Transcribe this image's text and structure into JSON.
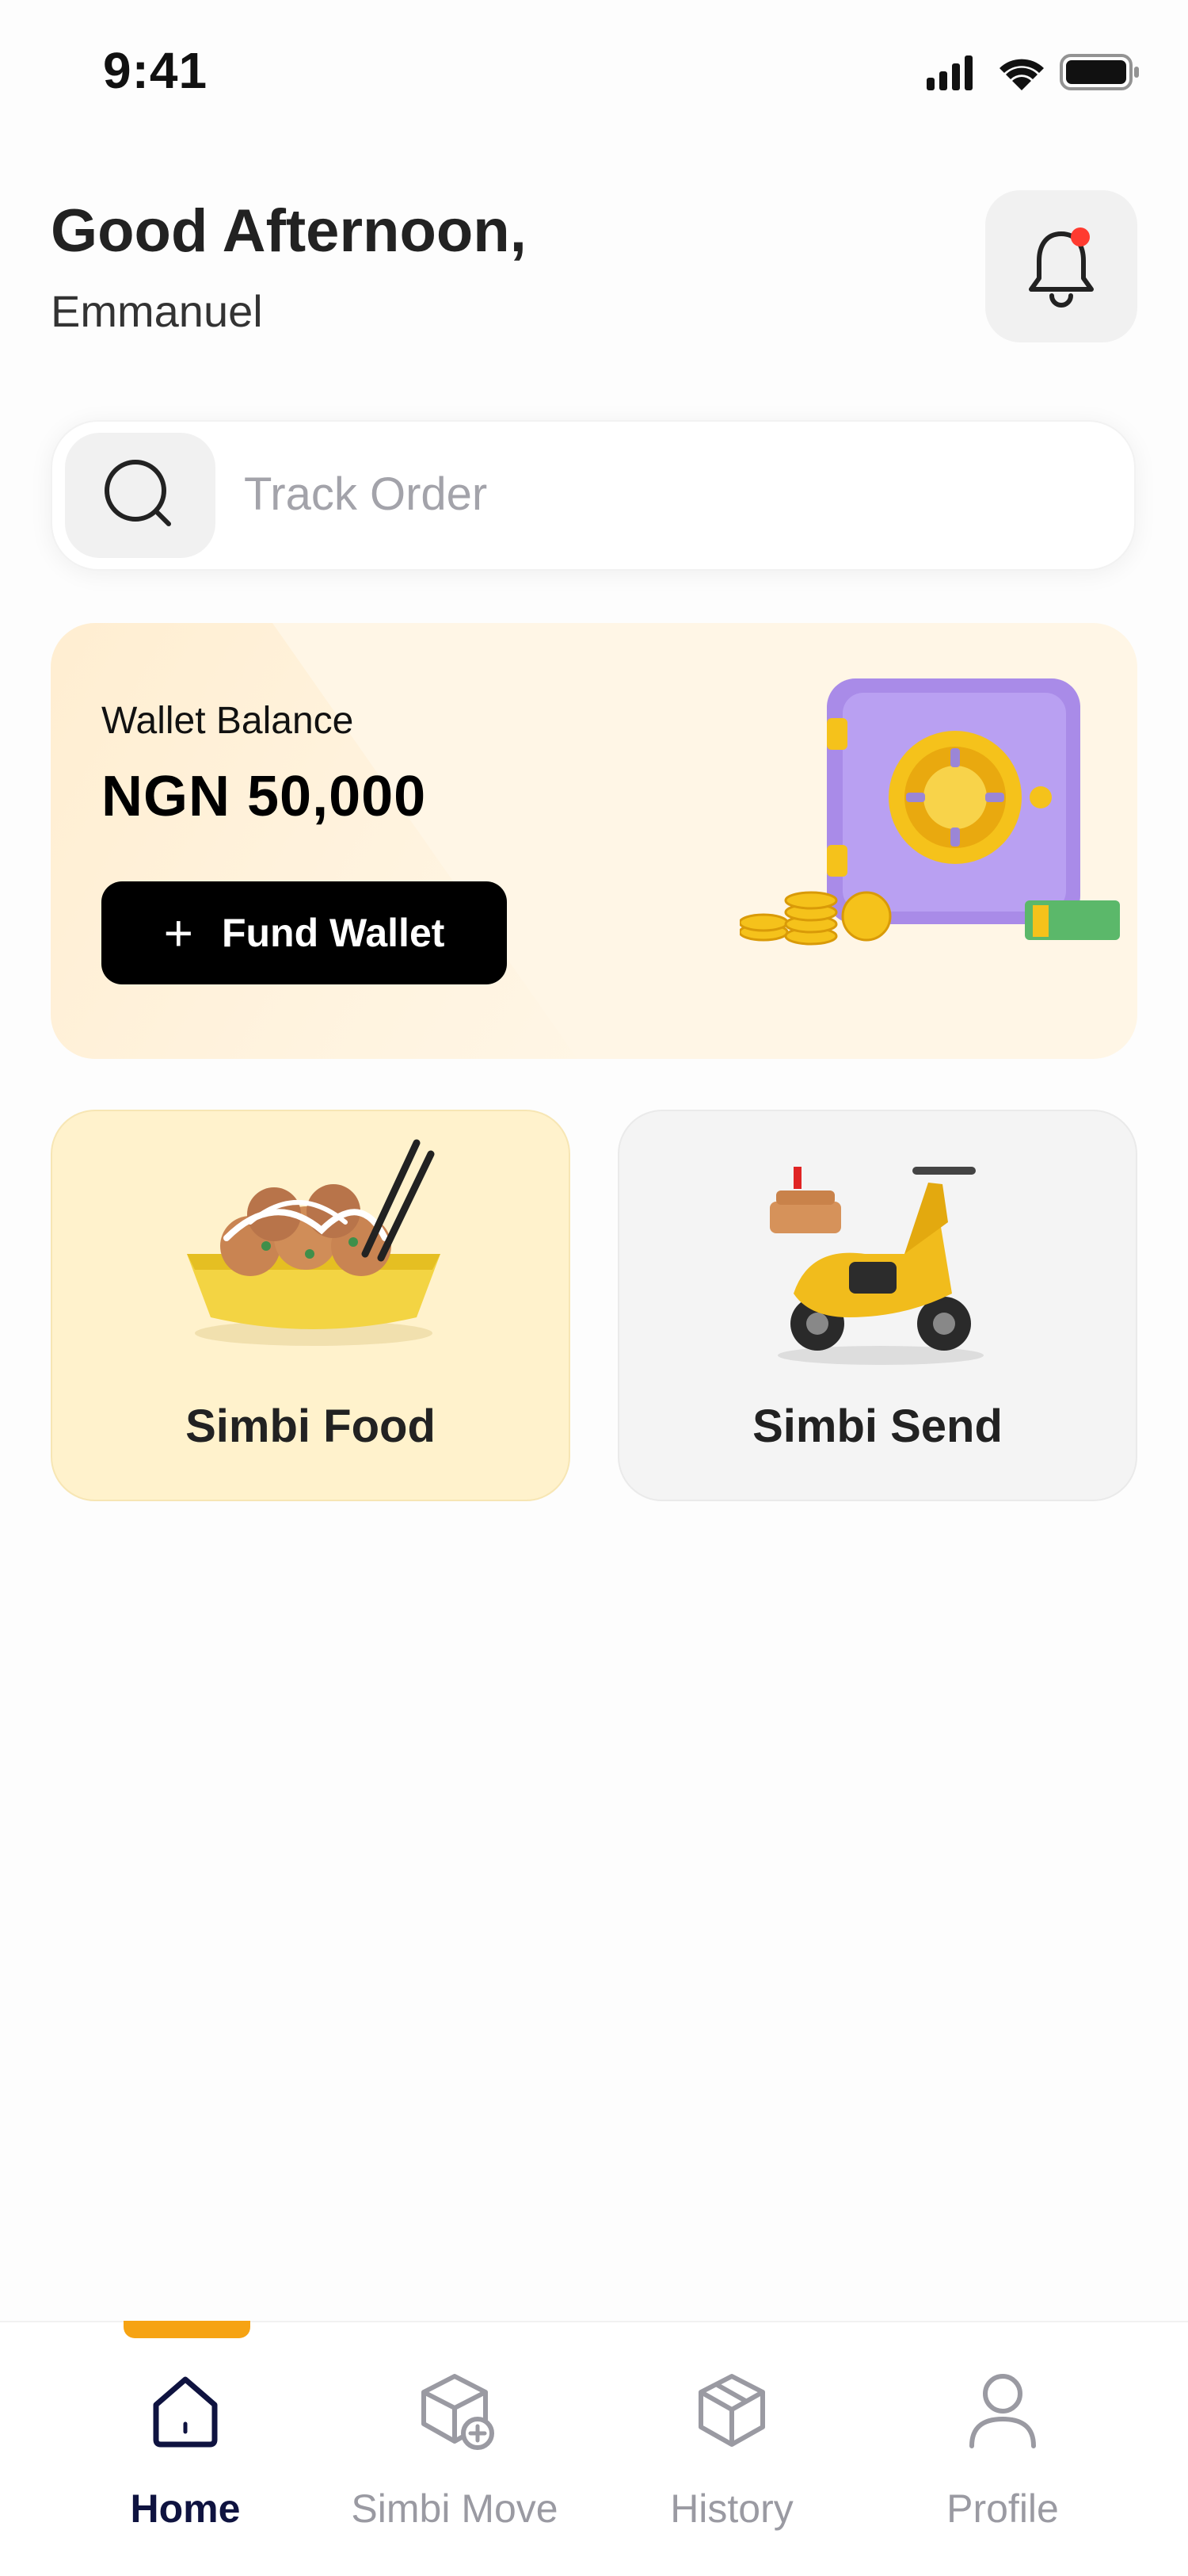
{
  "status_bar": {
    "time": "9:41"
  },
  "header": {
    "greeting": "Good Afternoon,",
    "name": "Emmanuel"
  },
  "search": {
    "placeholder": "Track Order"
  },
  "wallet": {
    "label": "Wallet Balance",
    "balance": "NGN 50,000",
    "fund_button_label": "Fund Wallet"
  },
  "services": [
    {
      "label": "Simbi Food",
      "icon": "food-bowl-icon"
    },
    {
      "label": "Simbi Send",
      "icon": "scooter-icon"
    }
  ],
  "nav": {
    "items": [
      {
        "label": "Home",
        "icon": "home-icon",
        "active": true
      },
      {
        "label": "Simbi Move",
        "icon": "box-add-icon",
        "active": false
      },
      {
        "label": "History",
        "icon": "box-icon",
        "active": false
      },
      {
        "label": "Profile",
        "icon": "user-icon",
        "active": false
      }
    ]
  },
  "colors": {
    "accent": "#f6a313",
    "nav_active": "#0f1340",
    "notification_dot": "#ff3b30",
    "wallet_bg": "#fff6e6",
    "safe_purple": "#a98be8"
  }
}
